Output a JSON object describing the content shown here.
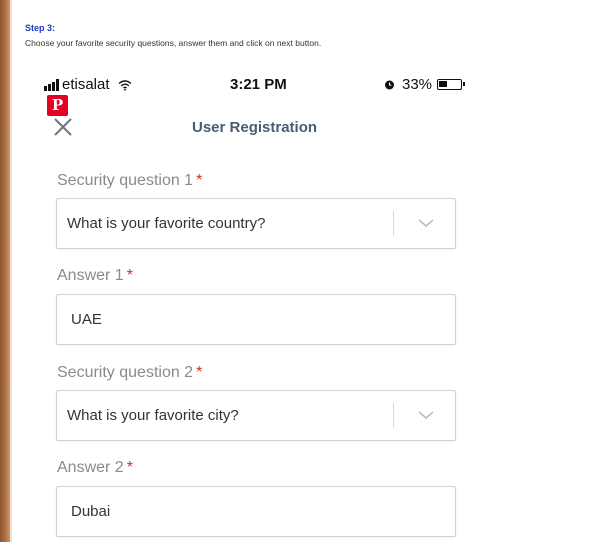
{
  "header": {
    "step_label": "Step 3:",
    "step_description": "Choose your favorite security questions, answer them and click on next button."
  },
  "status_bar": {
    "carrier": "etisalat",
    "time": "3:21 PM",
    "battery_percent": "33%",
    "battery_level": 0.33,
    "icons": [
      "signal-bars-icon",
      "wifi-icon",
      "alarm-icon",
      "battery-icon"
    ]
  },
  "nav": {
    "title": "User Registration",
    "close_icon": "close-icon",
    "pinterest_icon": "pinterest-icon",
    "pinterest_letter": "P"
  },
  "form": {
    "question1": {
      "label": "Security question 1",
      "required_mark": "*",
      "selected": "What is your favorite country?"
    },
    "answer1": {
      "label": "Answer 1",
      "required_mark": "*",
      "value": "UAE"
    },
    "question2": {
      "label": "Security question 2",
      "required_mark": "*",
      "selected": "What is your favorite city?"
    },
    "answer2": {
      "label": "Answer 2",
      "required_mark": "*",
      "value": "Dubai"
    }
  },
  "colors": {
    "step_label": "#1a37c7",
    "nav_title": "#4a5c73",
    "required": "#c2342d",
    "pinterest": "#e60023"
  }
}
